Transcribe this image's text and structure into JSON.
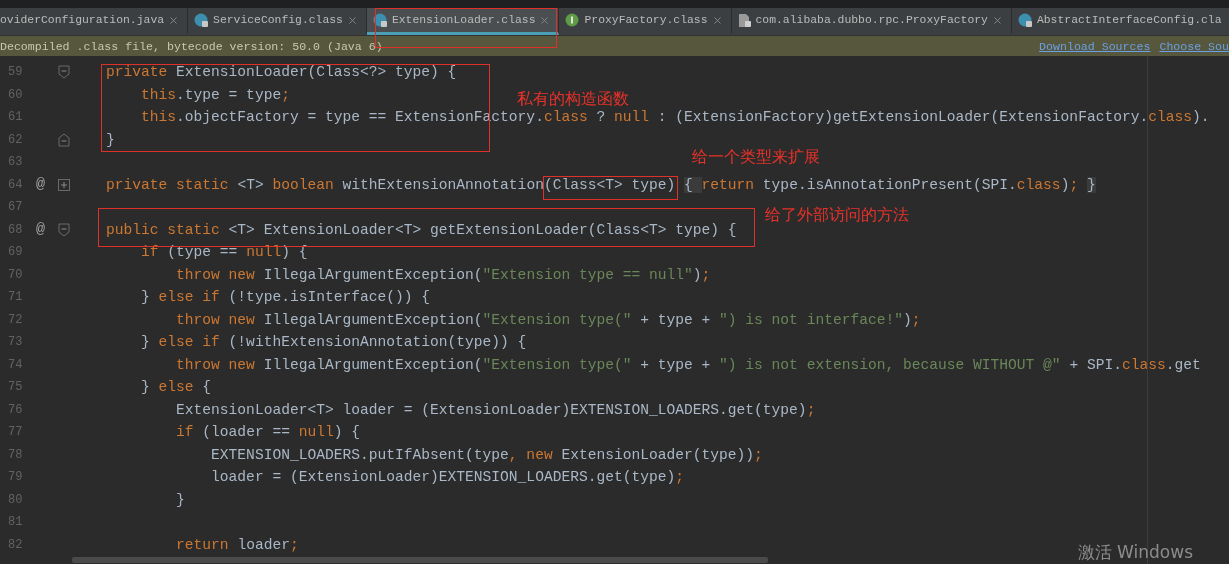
{
  "tabs": [
    {
      "label": "oviderConfiguration.java",
      "kind": "plain",
      "selected": false,
      "closable": true
    },
    {
      "label": "ServiceConfig.class",
      "kind": "class",
      "selected": false,
      "closable": true
    },
    {
      "label": "ExtensionLoader.class",
      "kind": "class",
      "selected": true,
      "closable": true
    },
    {
      "label": "ProxyFactory.class",
      "kind": "interface",
      "selected": false,
      "closable": true
    },
    {
      "label": "com.alibaba.dubbo.rpc.ProxyFactory",
      "kind": "file",
      "selected": false,
      "closable": true
    },
    {
      "label": "AbstractInterfaceConfig.cla",
      "kind": "class",
      "selected": false,
      "closable": false
    }
  ],
  "info_bar": {
    "message": "Decompiled .class file, bytecode version: 50.0 (Java 6)",
    "links": [
      "Download Sources",
      "Choose Sou"
    ]
  },
  "lines": [
    {
      "number": "59",
      "kind": "fold_start",
      "tokens": [
        {
          "kind": "kw",
          "text": "private "
        },
        {
          "kind": "plain",
          "text": "ExtensionLoader(Class<?> type) {"
        }
      ]
    },
    {
      "number": "60",
      "kind": "plain",
      "tokens": [
        {
          "kind": "kw",
          "text": "    this"
        },
        {
          "kind": "plain",
          "text": ".type = type"
        },
        {
          "kind": "kw",
          "text": ";"
        }
      ]
    },
    {
      "number": "61",
      "kind": "plain",
      "tokens": [
        {
          "kind": "kw",
          "text": "    this"
        },
        {
          "kind": "plain",
          "text": ".objectFactory = type == ExtensionFactory."
        },
        {
          "kind": "kw",
          "text": "class"
        },
        {
          "kind": "plain",
          "text": " ? "
        },
        {
          "kind": "kw",
          "text": "null"
        },
        {
          "kind": "plain",
          "text": " : (ExtensionFactory)getExtensionLoader(ExtensionFactory."
        },
        {
          "kind": "kw",
          "text": "class"
        },
        {
          "kind": "plain",
          "text": ")."
        }
      ]
    },
    {
      "number": "62",
      "kind": "fold_end",
      "tokens": [
        {
          "kind": "plain",
          "text": "}"
        }
      ]
    },
    {
      "number": "63",
      "kind": "plain"
    },
    {
      "number": "64",
      "kind": "folded",
      "marker": "@",
      "tokens": [
        {
          "kind": "kw",
          "text": "private static "
        },
        {
          "kind": "plain",
          "text": "<T> "
        },
        {
          "kind": "kw",
          "text": "boolean "
        },
        {
          "kind": "plain",
          "text": "withExtensionAnnotation(Class<T> type) "
        },
        {
          "kind": "folded",
          "text": "{ "
        },
        {
          "kind": "kw",
          "text": "return "
        },
        {
          "kind": "plain",
          "text": "type.isAnnotationPresent(SPI."
        },
        {
          "kind": "kw",
          "text": "class"
        },
        {
          "kind": "plain",
          "text": ")"
        },
        {
          "kind": "kw",
          "text": "; "
        },
        {
          "kind": "folded",
          "text": "}"
        }
      ]
    },
    {
      "number": "67",
      "kind": "plain"
    },
    {
      "number": "68",
      "kind": "fold_start",
      "marker": "@",
      "tokens": [
        {
          "kind": "kw",
          "text": "public static "
        },
        {
          "kind": "plain",
          "text": "<T> ExtensionLoader<T> getExtensionLoader(Class<T> type) {"
        }
      ]
    },
    {
      "number": "69",
      "kind": "plain",
      "tokens": [
        {
          "kind": "kw",
          "text": "    if "
        },
        {
          "kind": "plain",
          "text": "(type == "
        },
        {
          "kind": "kw",
          "text": "null"
        },
        {
          "kind": "plain",
          "text": ") {"
        }
      ]
    },
    {
      "number": "70",
      "kind": "plain",
      "tokens": [
        {
          "kind": "kw",
          "text": "        throw new "
        },
        {
          "kind": "plain",
          "text": "IllegalArgumentException("
        },
        {
          "kind": "str",
          "text": "\"Extension type == null\""
        },
        {
          "kind": "plain",
          "text": ")"
        },
        {
          "kind": "kw",
          "text": ";"
        }
      ]
    },
    {
      "number": "71",
      "kind": "plain",
      "tokens": [
        {
          "kind": "plain",
          "text": "    } "
        },
        {
          "kind": "kw",
          "text": "else if "
        },
        {
          "kind": "plain",
          "text": "(!type.isInterface()) {"
        }
      ]
    },
    {
      "number": "72",
      "kind": "plain",
      "tokens": [
        {
          "kind": "kw",
          "text": "        throw new "
        },
        {
          "kind": "plain",
          "text": "IllegalArgumentException("
        },
        {
          "kind": "str",
          "text": "\"Extension type(\""
        },
        {
          "kind": "plain",
          "text": " + type + "
        },
        {
          "kind": "str",
          "text": "\") is not interface!\""
        },
        {
          "kind": "plain",
          "text": ")"
        },
        {
          "kind": "kw",
          "text": ";"
        }
      ]
    },
    {
      "number": "73",
      "kind": "plain",
      "tokens": [
        {
          "kind": "plain",
          "text": "    } "
        },
        {
          "kind": "kw",
          "text": "else if "
        },
        {
          "kind": "plain",
          "text": "(!withExtensionAnnotation(type)) {"
        }
      ]
    },
    {
      "number": "74",
      "kind": "plain",
      "tokens": [
        {
          "kind": "kw",
          "text": "        throw new "
        },
        {
          "kind": "plain",
          "text": "IllegalArgumentException("
        },
        {
          "kind": "str",
          "text": "\"Extension type(\""
        },
        {
          "kind": "plain",
          "text": " + type + "
        },
        {
          "kind": "str",
          "text": "\") is not extension, because WITHOUT @\""
        },
        {
          "kind": "plain",
          "text": " + SPI."
        },
        {
          "kind": "kw",
          "text": "class"
        },
        {
          "kind": "plain",
          "text": ".get"
        }
      ]
    },
    {
      "number": "75",
      "kind": "plain",
      "tokens": [
        {
          "kind": "plain",
          "text": "    } "
        },
        {
          "kind": "kw",
          "text": "else "
        },
        {
          "kind": "plain",
          "text": "{"
        }
      ]
    },
    {
      "number": "76",
      "kind": "plain",
      "tokens": [
        {
          "kind": "plain",
          "text": "        ExtensionLoader<T> loader = (ExtensionLoader)EXTENSION_LOADERS.get(type)"
        },
        {
          "kind": "kw",
          "text": ";"
        }
      ]
    },
    {
      "number": "77",
      "kind": "plain",
      "tokens": [
        {
          "kind": "kw",
          "text": "        if "
        },
        {
          "kind": "plain",
          "text": "(loader == "
        },
        {
          "kind": "kw",
          "text": "null"
        },
        {
          "kind": "plain",
          "text": ") {"
        }
      ]
    },
    {
      "number": "78",
      "kind": "plain",
      "tokens": [
        {
          "kind": "plain",
          "text": "            EXTENSION_LOADERS.putIfAbsent(type"
        },
        {
          "kind": "kw",
          "text": ", new "
        },
        {
          "kind": "plain",
          "text": "ExtensionLoader(type))"
        },
        {
          "kind": "kw",
          "text": ";"
        }
      ]
    },
    {
      "number": "79",
      "kind": "plain",
      "tokens": [
        {
          "kind": "plain",
          "text": "            loader = (ExtensionLoader)EXTENSION_LOADERS.get(type)"
        },
        {
          "kind": "kw",
          "text": ";"
        }
      ]
    },
    {
      "number": "80",
      "kind": "plain",
      "tokens": [
        {
          "kind": "plain",
          "text": "        }"
        }
      ]
    },
    {
      "number": "81",
      "kind": "plain"
    },
    {
      "number": "82",
      "kind": "plain",
      "tokens": [
        {
          "kind": "kw",
          "text": "        return "
        },
        {
          "kind": "plain",
          "text": "loader"
        },
        {
          "kind": "kw",
          "text": ";"
        }
      ]
    }
  ],
  "annotations": [
    {
      "note": "私有的构造函数"
    },
    {
      "note": "给一个类型来扩展"
    },
    {
      "note": "给了外部访问的方法"
    }
  ],
  "system_overlay": "激活 Windows"
}
